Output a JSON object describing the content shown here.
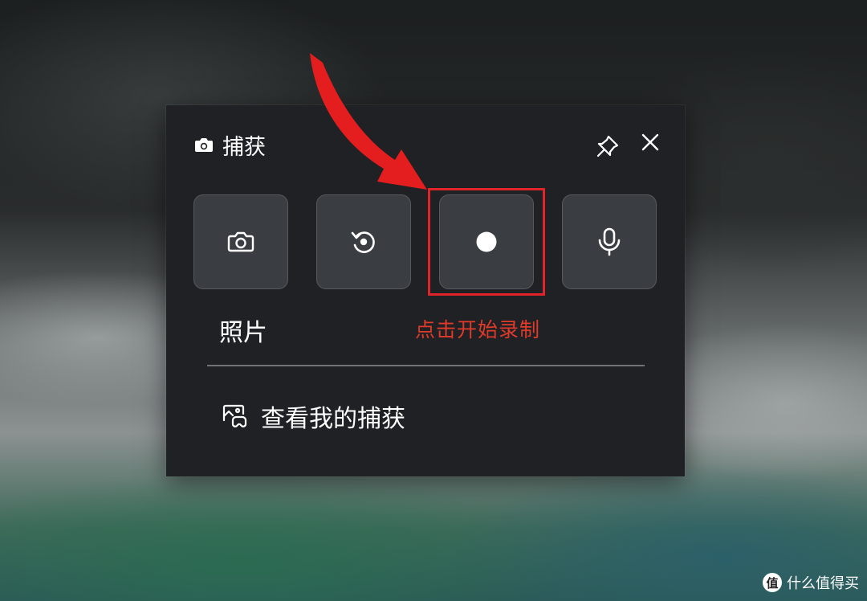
{
  "capture_widget": {
    "title": "捕获",
    "buttons": [
      {
        "name": "screenshot",
        "icon": "camera-icon"
      },
      {
        "name": "record-last-30s",
        "icon": "replay-icon"
      },
      {
        "name": "start-recording",
        "icon": "record-dot-icon"
      },
      {
        "name": "microphone",
        "icon": "microphone-icon"
      }
    ],
    "screenshot_label": "照片",
    "view_captures_label": "查看我的捕获"
  },
  "annotation": {
    "text": "点击开始录制",
    "color": "#e03a2a"
  },
  "watermark": {
    "badge": "值",
    "text": "什么值得买"
  }
}
